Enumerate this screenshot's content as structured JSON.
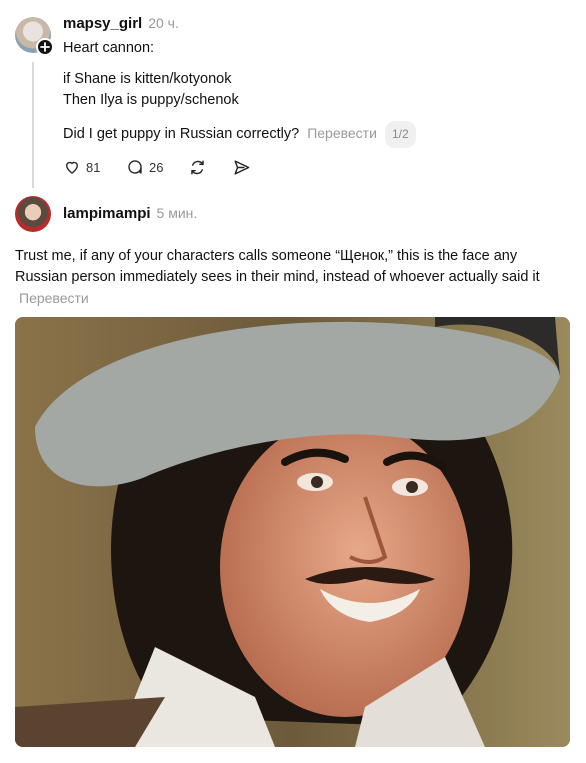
{
  "post1": {
    "username": "mapsy_girl",
    "time": "20 ч.",
    "line1": "Heart cannon:",
    "line2": "if Shane is kitten/kotyonok",
    "line3": "Then Ilya is puppy/schenok",
    "line4": "Did I get puppy in Russian correctly?",
    "translate": "Перевести",
    "page_badge": "1/2",
    "likes": "81",
    "comments": "26"
  },
  "post2": {
    "username": "lampimampi",
    "time": "5 мин.",
    "text": "Trust me, if any of your characters calls someone “Щенок,” this is the face any Russian person immediately sees in their mind, instead of whoever actually said it",
    "translate": "Перевести"
  },
  "colors": {
    "muted": "#9a9a9a",
    "thread": "#d9d9d9"
  },
  "icons": [
    "plus-icon",
    "heart-icon",
    "comment-icon",
    "repost-icon",
    "share-icon"
  ]
}
